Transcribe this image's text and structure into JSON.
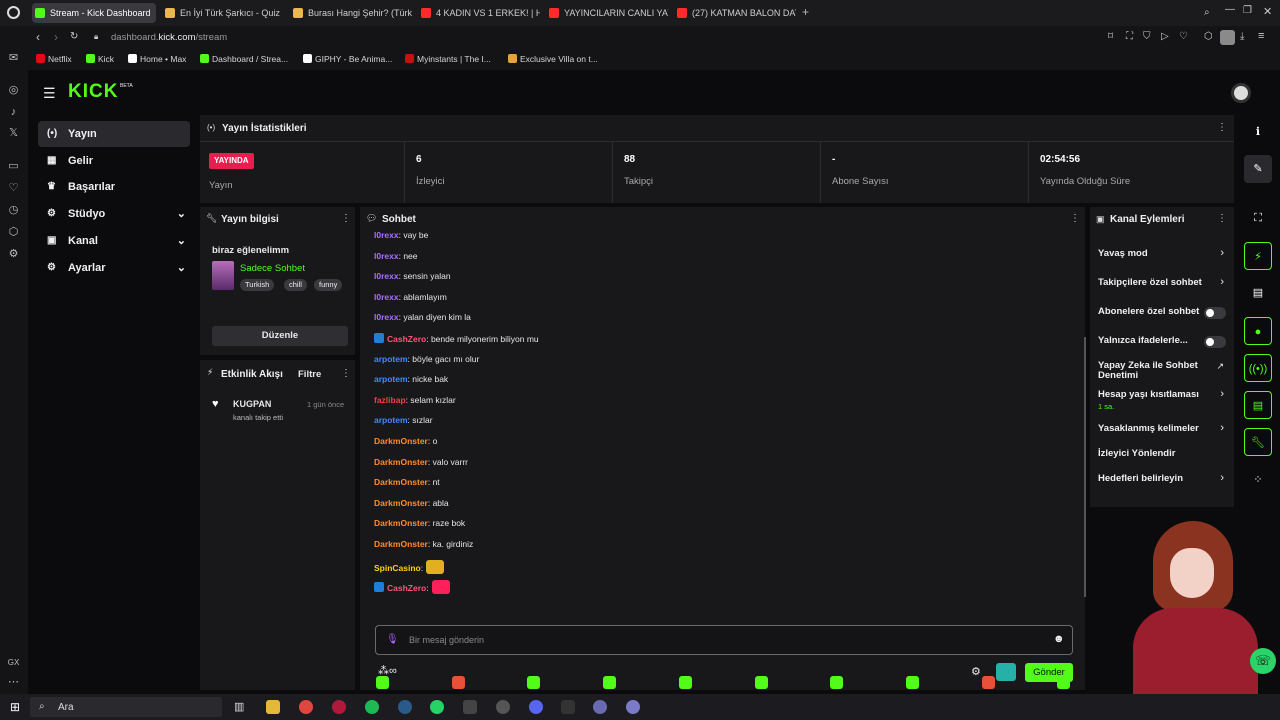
{
  "browser": {
    "tabs": [
      {
        "title": "Stream - Kick Dashboard",
        "color": "#53fc18",
        "active": true
      },
      {
        "title": "En İyi Türk Şarkıcı - Quiz",
        "color": "#e9b949"
      },
      {
        "title": "Burası Hangi Şehir? (Türk",
        "color": "#e9b949"
      },
      {
        "title": "4 KADIN VS 1 ERKEK! | Ha",
        "color": "#ff2b2b"
      },
      {
        "title": "YAYINCILARIN CANLI YAY",
        "color": "#ff2b2b"
      },
      {
        "title": "(27) KATMAN BALON DAT",
        "color": "#ff2b2b"
      }
    ],
    "new_tab_label": "+",
    "url_prefix": "dashboard.",
    "url_host": "kick.com",
    "url_path": "/stream",
    "bookmarks": [
      {
        "label": "Netflix",
        "color": "#e50914"
      },
      {
        "label": "Kick",
        "color": "#53fc18"
      },
      {
        "label": "Home • Max",
        "color": "#ffffff"
      },
      {
        "label": "Dashboard / Strea...",
        "color": "#53fc18"
      },
      {
        "label": "GIPHY - Be Anima...",
        "color": "#ffffff"
      },
      {
        "label": "Myinstants | The I...",
        "color": "#c81010"
      },
      {
        "label": "Exclusive Villa on t...",
        "color": "#e6a23c"
      }
    ]
  },
  "header": {
    "logo": "KICK",
    "logo_badge": "BETA"
  },
  "nav": [
    {
      "label": "Yayın",
      "icon": "broadcast-icon",
      "glyph": "(•)",
      "active": true
    },
    {
      "label": "Gelir",
      "icon": "revenue-icon",
      "glyph": "▦"
    },
    {
      "label": "Başarılar",
      "icon": "trophy-icon",
      "glyph": "♛"
    },
    {
      "label": "Stüdyo",
      "icon": "studio-icon",
      "glyph": "⚙",
      "expandable": true
    },
    {
      "label": "Kanal",
      "icon": "channel-icon",
      "glyph": "▣",
      "expandable": true
    },
    {
      "label": "Ayarlar",
      "icon": "settings-icon",
      "glyph": "⚙",
      "expandable": true
    }
  ],
  "stats": {
    "title": "Yayın İstatistikleri",
    "live_badge": "YAYINDA",
    "live_label": "Yayın",
    "items": [
      {
        "value": "6",
        "label": "İzleyici"
      },
      {
        "value": "88",
        "label": "Takipçi"
      },
      {
        "value": "-",
        "label": "Abone Sayısı"
      },
      {
        "value": "02:54:56",
        "label": "Yayında Olduğu Süre"
      }
    ]
  },
  "stream_info": {
    "title": "Yayın bilgisi",
    "stream_title": "biraz eğlenelimm",
    "category": "Sadece Sohbet",
    "tags": [
      "Turkish",
      "chill",
      "funny"
    ],
    "edit_button": "Düzenle"
  },
  "activity": {
    "title": "Etkinlik Akışı",
    "filter": "Filtre",
    "events": [
      {
        "user": "KUGPAN",
        "text": "kanalı takip etti",
        "time": "1 gün önce"
      }
    ]
  },
  "chat": {
    "title": "Sohbet",
    "messages": [
      {
        "user": "l0rexx",
        "text": ": vay be",
        "color": "#a970ff"
      },
      {
        "user": "l0rexx",
        "text": ": nee",
        "color": "#a970ff"
      },
      {
        "user": "l0rexx",
        "text": ": sensin yalan",
        "color": "#a970ff"
      },
      {
        "user": "l0rexx",
        "text": ": ablamlayım",
        "color": "#a970ff"
      },
      {
        "user": "l0rexx",
        "text": ": yalan diyen kim la",
        "color": "#a970ff"
      },
      {
        "user": "CashZero",
        "text": ": bende milyonerim biliyon mu",
        "color": "#ff5577",
        "badge": true
      },
      {
        "user": "arpotem",
        "text": ": böyle gacı mı olur",
        "color": "#3d8bff"
      },
      {
        "user": "arpotem",
        "text": ": nicke bak",
        "color": "#3d8bff"
      },
      {
        "user": "fazlibap",
        "text": ": selam kızlar",
        "color": "#ff3b3b"
      },
      {
        "user": "arpotem",
        "text": ": sızlar",
        "color": "#3d8bff"
      },
      {
        "user": "DarkmOnster",
        "text": ": o",
        "color": "#ff8c2a"
      },
      {
        "user": "DarkmOnster",
        "text": ": valo varrr",
        "color": "#ff8c2a"
      },
      {
        "user": "DarkmOnster",
        "text": ": nt",
        "color": "#ff8c2a"
      },
      {
        "user": "DarkmOnster",
        "text": ": abla",
        "color": "#ff8c2a"
      },
      {
        "user": "DarkmOnster",
        "text": ": raze bok",
        "color": "#ff8c2a"
      },
      {
        "user": "DarkmOnster",
        "text": ": ka. girdiniz",
        "color": "#ff8c2a"
      },
      {
        "user": "SpinCasino",
        "text": ":",
        "color": "#ffd400",
        "emote": "#e0b020"
      },
      {
        "user": "CashZero",
        "text": ":",
        "color": "#ff5577",
        "badge": true,
        "emote": "#ff1f5a"
      }
    ],
    "input_placeholder": "Bir mesaj gönderin",
    "send_button": "Gönder"
  },
  "channel_actions": {
    "title": "Kanal Eylemleri",
    "items": [
      {
        "label": "Yavaş mod",
        "control": "chevron"
      },
      {
        "label": "Takipçilere özel sohbet",
        "control": "chevron"
      },
      {
        "label": "Abonelere özel sohbet",
        "control": "toggle"
      },
      {
        "label": "Yalnızca ifadelerle...",
        "control": "toggle"
      },
      {
        "label": "Yapay Zeka ile Sohbet Denetimi",
        "control": "external"
      },
      {
        "label": "Hesap yaşı kısıtlaması",
        "sub": "1 sa.",
        "control": "chevron"
      },
      {
        "label": "Yasaklanmış kelimeler",
        "control": "chevron"
      },
      {
        "label": "İzleyici Yönlendir",
        "control": "none"
      },
      {
        "label": "Hedefleri belirleyin",
        "control": "chevron"
      }
    ]
  },
  "taskbar": {
    "search_label": "Ara"
  },
  "colors": {
    "accent": "#53fc18",
    "live": "#e91e4f",
    "panel": "#18181b"
  }
}
